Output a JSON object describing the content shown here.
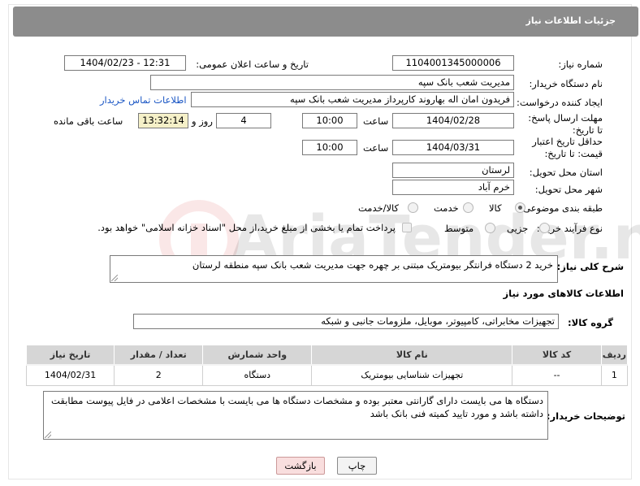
{
  "header": {
    "title": "جزئیات اطلاعات نیاز"
  },
  "fields": {
    "need_number": {
      "label": "شماره نیاز:",
      "value": "1104001345000006"
    },
    "announce_datetime": {
      "label": "تاریخ و ساعت اعلان عمومی:",
      "value": "1404/02/23 - 12:31"
    },
    "buyer_org": {
      "label": "نام دستگاه خریدار:",
      "value": "مدیریت شعب بانک سپه"
    },
    "requester": {
      "label": "ایجاد کننده درخواست:",
      "value": "فریدون امان اله بهاروند کارپرداز مدیریت شعب بانک سپه",
      "contact_link": "اطلاعات تماس خریدار"
    },
    "deadline": {
      "label": "مهلت ارسال پاسخ: تا تاریخ:",
      "date": "1404/02/28",
      "time_label": "ساعت",
      "time": "10:00",
      "days": "4",
      "days_label": "روز و",
      "remaining": "13:32:14",
      "remaining_label": "ساعت باقی مانده"
    },
    "price_validity": {
      "label": "حداقل تاریخ اعتبار قیمت: تا تاریخ:",
      "date": "1404/03/31",
      "time_label": "ساعت",
      "time": "10:00"
    },
    "province": {
      "label": "استان محل تحویل:",
      "value": "لرستان"
    },
    "city": {
      "label": "شهر محل تحویل:",
      "value": "خرم آباد"
    },
    "category": {
      "label": "طبقه بندی موضوعی:",
      "options": [
        {
          "label": "کالا",
          "checked": true
        },
        {
          "label": "خدمت",
          "checked": false
        },
        {
          "label": "کالا/خدمت",
          "checked": false
        }
      ]
    },
    "process_type": {
      "label": "نوع فرآیند خرید :",
      "options": [
        {
          "label": "جزیی",
          "checked": false
        },
        {
          "label": "متوسط",
          "checked": false
        }
      ],
      "payment_note": "پرداخت تمام یا بخشی از مبلغ خرید،از محل \"اسناد خزانه اسلامی\" خواهد بود."
    }
  },
  "description": {
    "label": "شرح کلی نیاز:",
    "value": "خرید 2 دستگاه فرانتگر بیومتریک مبتنی بر چهره جهت مدیریت شعب بانک سپه منطقه لرستان"
  },
  "goods_section": {
    "title": "اطلاعات کالاهای مورد نیاز"
  },
  "goods_group": {
    "label": "گروه کالا:",
    "value": "تجهیزات مخابراتی، کامپیوتر، موبایل، ملزومات جانبی و شبکه"
  },
  "table": {
    "headers": [
      "ردیف",
      "کد کالا",
      "نام کالا",
      "واحد شمارش",
      "تعداد / مقدار",
      "تاریخ نیاز"
    ],
    "rows": [
      [
        "1",
        "--",
        "تجهیزات شناسایی بیومتریک",
        "دستگاه",
        "2",
        "1404/02/31"
      ]
    ]
  },
  "buyer_notes": {
    "label": "توضیحات خریدار:",
    "value": "دستگاه ها می بایست دارای گارانتی معتبر بوده و مشخصات دستگاه ها می بایست با مشخصات اعلامی در فایل  پیوست مطابقت داشته باشد و مورد تایید کمیته فنی بانک باشد"
  },
  "buttons": {
    "print": "چاپ",
    "back": "بازگشت"
  },
  "watermark": {
    "text": "AriaTender.neT"
  },
  "colors": {
    "header_bg": "#8c8c8c",
    "link": "#1a56c4",
    "remaining_bg": "#f5f0c8",
    "back_bg": "#f9dede"
  }
}
